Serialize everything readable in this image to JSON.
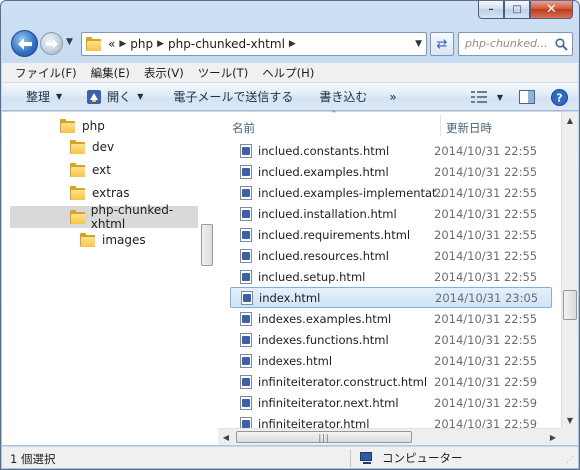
{
  "caption": {
    "minimize": "–",
    "maximize": "□",
    "close": "✕"
  },
  "nav": {
    "breadcrumb_lead": "«",
    "breadcrumbs": [
      "php",
      "php-chunked-xhtml"
    ],
    "search_placeholder": "php-chunked..."
  },
  "menubar": [
    "ファイル(F)",
    "編集(E)",
    "表示(V)",
    "ツール(T)",
    "ヘルプ(H)"
  ],
  "commandbar": {
    "organize": "整理",
    "open": "開く",
    "email": "電子メールで送信する",
    "burn": "書き込む",
    "more": "»"
  },
  "tree": [
    {
      "label": "php",
      "level": 0,
      "selected": false
    },
    {
      "label": "dev",
      "level": 1,
      "selected": false
    },
    {
      "label": "ext",
      "level": 1,
      "selected": false
    },
    {
      "label": "extras",
      "level": 1,
      "selected": false
    },
    {
      "label": "php-chunked-xhtml",
      "level": 1,
      "selected": true
    },
    {
      "label": "images",
      "level": 2,
      "selected": false
    }
  ],
  "columns": {
    "name": "名前",
    "modified": "更新日時"
  },
  "files": [
    {
      "name": "inclued.constants.html",
      "date": "2014/10/31 22:55",
      "selected": false
    },
    {
      "name": "inclued.examples.html",
      "date": "2014/10/31 22:55",
      "selected": false
    },
    {
      "name": "inclued.examples-implementat...",
      "date": "2014/10/31 22:55",
      "selected": false
    },
    {
      "name": "inclued.installation.html",
      "date": "2014/10/31 22:55",
      "selected": false
    },
    {
      "name": "inclued.requirements.html",
      "date": "2014/10/31 22:55",
      "selected": false
    },
    {
      "name": "inclued.resources.html",
      "date": "2014/10/31 22:55",
      "selected": false
    },
    {
      "name": "inclued.setup.html",
      "date": "2014/10/31 22:55",
      "selected": false
    },
    {
      "name": "index.html",
      "date": "2014/10/31 23:05",
      "selected": true
    },
    {
      "name": "indexes.examples.html",
      "date": "2014/10/31 22:55",
      "selected": false
    },
    {
      "name": "indexes.functions.html",
      "date": "2014/10/31 22:55",
      "selected": false
    },
    {
      "name": "indexes.html",
      "date": "2014/10/31 22:55",
      "selected": false
    },
    {
      "name": "infiniteiterator.construct.html",
      "date": "2014/10/31 22:59",
      "selected": false
    },
    {
      "name": "infiniteiterator.next.html",
      "date": "2014/10/31 22:59",
      "selected": false
    },
    {
      "name": "infiniteiterator.html",
      "date": "2014/10/31 22:59",
      "selected": false
    }
  ],
  "status": {
    "selection": "1 個選択",
    "location": "コンピューター"
  }
}
